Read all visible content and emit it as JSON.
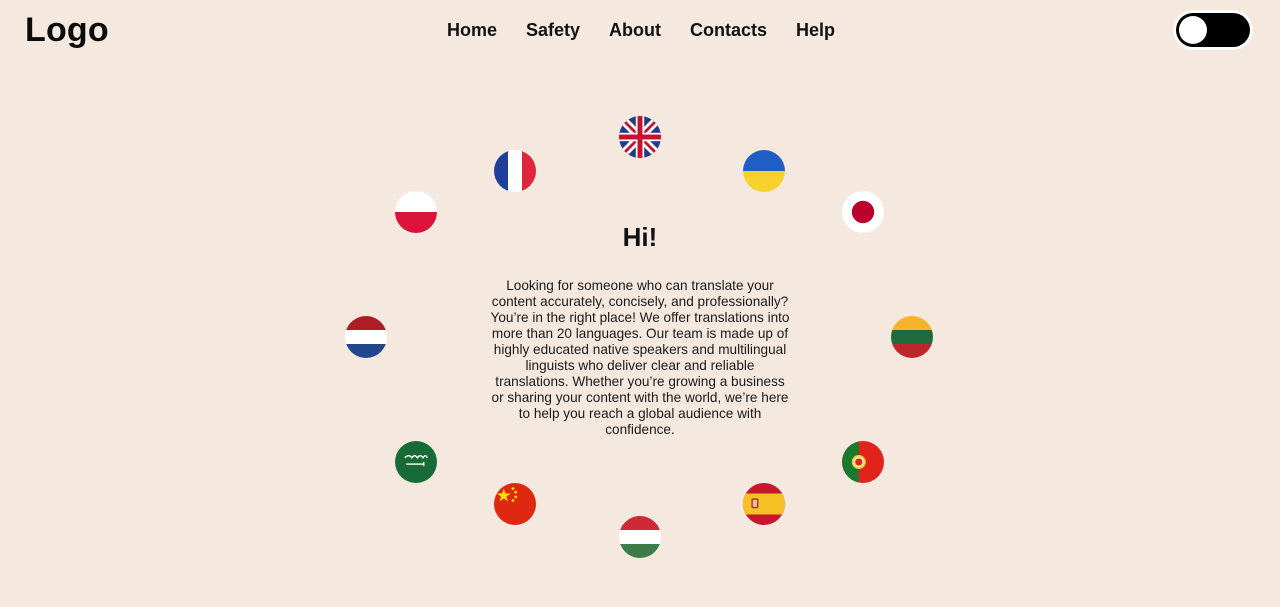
{
  "header": {
    "logo": "Logo",
    "nav": [
      {
        "label": "Home"
      },
      {
        "label": "Safety"
      },
      {
        "label": "About"
      },
      {
        "label": "Contacts"
      },
      {
        "label": "Help"
      }
    ],
    "theme_toggle": {
      "state": "off",
      "track_color": "#000000",
      "knob_color": "#ffffff"
    }
  },
  "hero": {
    "title": "Hi!",
    "body": "Looking for someone who can translate your content accurately, concisely, and professionally? You’re in the right place! We offer translations into more than 20 languages. Our team is made up of highly educated native speakers and multilingual linguists who deliver clear and reliable translations. Whether you’re growing a business or sharing your content with the world, we’re here to help you reach a global audience with confidence."
  },
  "flags": [
    {
      "icon": "uk-flag-icon"
    },
    {
      "icon": "ukraine-flag-icon"
    },
    {
      "icon": "japan-flag-icon"
    },
    {
      "icon": "lithuania-flag-icon"
    },
    {
      "icon": "portugal-flag-icon"
    },
    {
      "icon": "spain-flag-icon"
    },
    {
      "icon": "hungary-flag-icon"
    },
    {
      "icon": "china-flag-icon"
    },
    {
      "icon": "saudi-arabia-flag-icon"
    },
    {
      "icon": "netherlands-flag-icon"
    },
    {
      "icon": "poland-flag-icon"
    },
    {
      "icon": "france-flag-icon"
    }
  ],
  "colors": {
    "background": "#f5e9df",
    "text": "#111111"
  }
}
